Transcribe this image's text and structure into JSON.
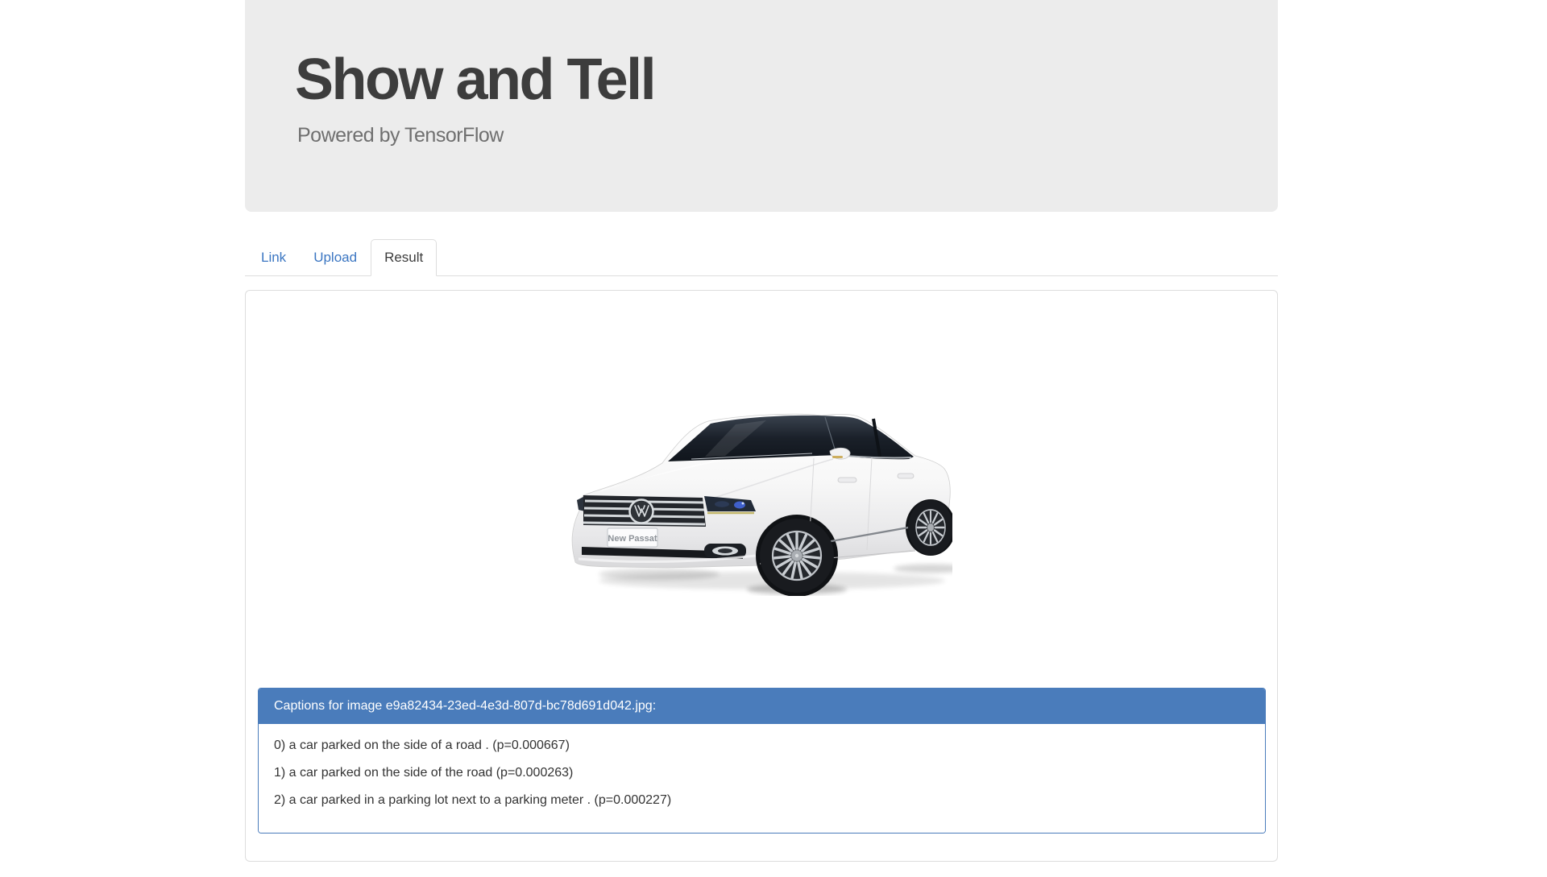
{
  "header": {
    "title": "Show and Tell",
    "subtitle": "Powered by TensorFlow",
    "background_color": "#ececec"
  },
  "tabs": {
    "items": [
      {
        "label": "Link",
        "active": false
      },
      {
        "label": "Upload",
        "active": false
      },
      {
        "label": "Result",
        "active": true
      }
    ],
    "link_color": "#3b76c2",
    "active_text_color": "#3c3c3c"
  },
  "result": {
    "image": {
      "description": "white Volkswagen New Passat sedan, front three-quarter view on white background",
      "badge_label": "New Passat"
    },
    "captions_panel": {
      "heading": "Captions for image e9a82434-23ed-4e3d-807d-bc78d691d042.jpg:",
      "accent_color": "#4a7cbb",
      "captions": [
        "0) a car parked on the side of a road . (p=0.000667)",
        "1) a car parked on the side of the road (p=0.000263)",
        "2) a car parked in a parking lot next to a parking meter . (p=0.000227)"
      ]
    }
  }
}
